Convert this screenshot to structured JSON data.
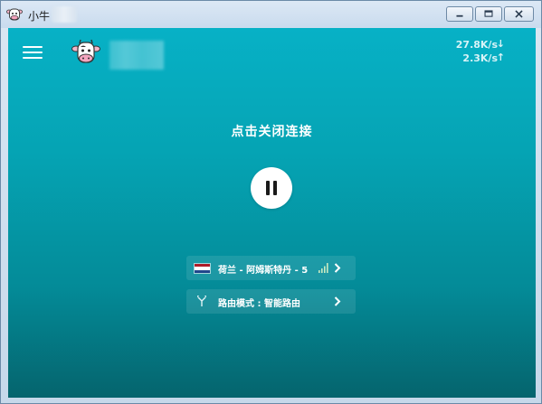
{
  "window": {
    "title": "小牛",
    "buttons": {
      "minimize_icon": "minimize-icon",
      "restore_icon": "restore-icon",
      "close_icon": "close-icon"
    }
  },
  "header": {
    "menu_icon": "hamburger-menu-icon",
    "logo_icon": "cow-logo-icon",
    "download_speed": "27.8K/s",
    "upload_speed": "2.3K/s",
    "download_arrow": "↓",
    "upload_arrow": "↑"
  },
  "main": {
    "connect_label": "点击关闭连接",
    "pause_icon": "pause-icon"
  },
  "server": {
    "label": "荷兰 - 阿姆斯特丹 - 5",
    "flag_colors": [
      "#ae1c28",
      "#ffffff",
      "#21468b"
    ],
    "signal_icon": "signal-strength-icon",
    "signal_level": 4
  },
  "route": {
    "label": "路由模式 : 智能路由",
    "icon": "route-fork-icon"
  },
  "colors": {
    "accent_top": "#07b1c6",
    "accent_bottom": "#05646d"
  }
}
